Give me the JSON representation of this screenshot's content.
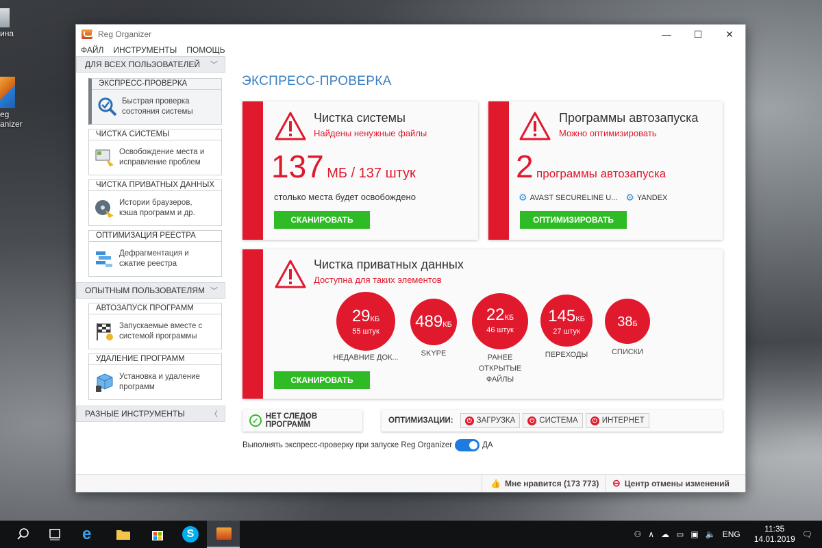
{
  "desktop": {
    "icon1_label": "ина",
    "icon2_label_1": "eg",
    "icon2_label_2": "anizer"
  },
  "window": {
    "title": "Reg Organizer",
    "min": "—",
    "max": "☐",
    "close": "✕"
  },
  "menu": [
    "ФАЙЛ",
    "ИНСТРУМЕНТЫ",
    "ПОМОЩЬ"
  ],
  "sidebar": {
    "cat_all": "ДЛЯ ВСЕХ ПОЛЬЗОВАТЕЛЕЙ",
    "items_all": [
      {
        "head": "ЭКСПРЕСС-ПРОВЕРКА",
        "l1": "Быстрая проверка",
        "l2": "состояния системы"
      },
      {
        "head": "ЧИСТКА СИСТЕМЫ",
        "l1": "Освобождение места и",
        "l2": "исправление проблем"
      },
      {
        "head": "ЧИСТКА ПРИВАТНЫХ ДАННЫХ",
        "l1": "Истории браузеров,",
        "l2": "кэша программ и др."
      },
      {
        "head": "ОПТИМИЗАЦИЯ РЕЕСТРА",
        "l1": "Дефрагментация и",
        "l2": "сжатие реестра"
      }
    ],
    "cat_exp": "ОПЫТНЫМ ПОЛЬЗОВАТЕЛЯМ",
    "items_exp": [
      {
        "head": "АВТОЗАПУСК ПРОГРАММ",
        "l1": "Запускаемые вместе с",
        "l2": "системой программы"
      },
      {
        "head": "УДАЛЕНИЕ ПРОГРАММ",
        "l1": "Установка и удаление",
        "l2": "программ"
      }
    ],
    "cat_misc": "РАЗНЫЕ ИНСТРУМЕНТЫ"
  },
  "main": {
    "title": "ЭКСПРЕСС-ПРОВЕРКА",
    "clean": {
      "title": "Чистка системы",
      "sub": "Найдены ненужные файлы",
      "num": "137",
      "unit": "МБ / 137 штук",
      "desc": "столько места будет освобождено",
      "btn": "СКАНИРОВАТЬ"
    },
    "autorun": {
      "title": "Программы автозапуска",
      "sub": "Можно оптимизировать",
      "num": "2",
      "unit": "программы автозапуска",
      "app1": "AVAST SECURELINE U...",
      "app2": "YANDEX",
      "btn": "ОПТИМИЗИРОВАТЬ"
    },
    "private": {
      "title": "Чистка приватных данных",
      "sub": "Доступна для таких элементов",
      "btn": "СКАНИРОВАТЬ",
      "items": [
        {
          "value": "29",
          "unit": "КБ",
          "count": "55 штук",
          "label": "НЕДАВНИЕ ДОК..."
        },
        {
          "value": "489",
          "unit": "КБ",
          "count": "",
          "label": "SKYPE"
        },
        {
          "value": "22",
          "unit": "КБ",
          "count": "46 штук",
          "label": "РАНЕЕ ОТКРЫТЫЕ ФАЙЛЫ"
        },
        {
          "value": "145",
          "unit": "КБ",
          "count": "27 штук",
          "label": "ПЕРЕХОДЫ"
        },
        {
          "value": "38",
          "unit": "Б",
          "count": "",
          "label": "СПИСКИ"
        }
      ]
    },
    "notrace": "НЕТ СЛЕДОВ ПРОГРАММ",
    "opt_label": "ОПТИМИЗАЦИИ:",
    "opt": [
      "ЗАГРУЗКА",
      "СИСТЕМА",
      "ИНТЕРНЕТ"
    ],
    "startup_text": "Выполнять экспресс-проверку при запуске Reg Organizer",
    "startup_val": "ДА"
  },
  "status": {
    "like": "Мне нравится (173 773)",
    "undo": "Центр отмены изменений"
  },
  "taskbar": {
    "lang": "ENG",
    "time": "11:35",
    "date": "14.01.2019"
  }
}
